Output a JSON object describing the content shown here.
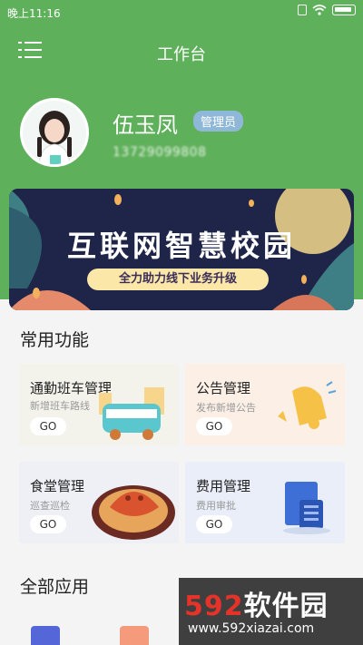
{
  "status_bar": {
    "time": "晚上11:16"
  },
  "header": {
    "title": "工作台"
  },
  "profile": {
    "name": "伍玉凤",
    "role": "管理员",
    "phone": "13729099808"
  },
  "banner": {
    "title": "互联网智慧校园",
    "subtitle": "全力助力线下业务升级"
  },
  "common_functions": {
    "title": "常用功能",
    "cards": [
      {
        "title": "通勤班车管理",
        "subtitle": "新增班车路线",
        "go": "GO"
      },
      {
        "title": "公告管理",
        "subtitle": "发布新增公告",
        "go": "GO"
      },
      {
        "title": "食堂管理",
        "subtitle": "巡查巡检",
        "go": "GO"
      },
      {
        "title": "费用管理",
        "subtitle": "费用审批",
        "go": "GO"
      }
    ]
  },
  "all_apps": {
    "title": "全部应用"
  },
  "watermark": {
    "brand_num": "592",
    "brand_text": "软件园",
    "url": "www.592xiazai.com"
  },
  "colors": {
    "header_green": "#5fb05b",
    "role_badge": "#8fb8d8",
    "banner_bg": "#1e2549"
  }
}
